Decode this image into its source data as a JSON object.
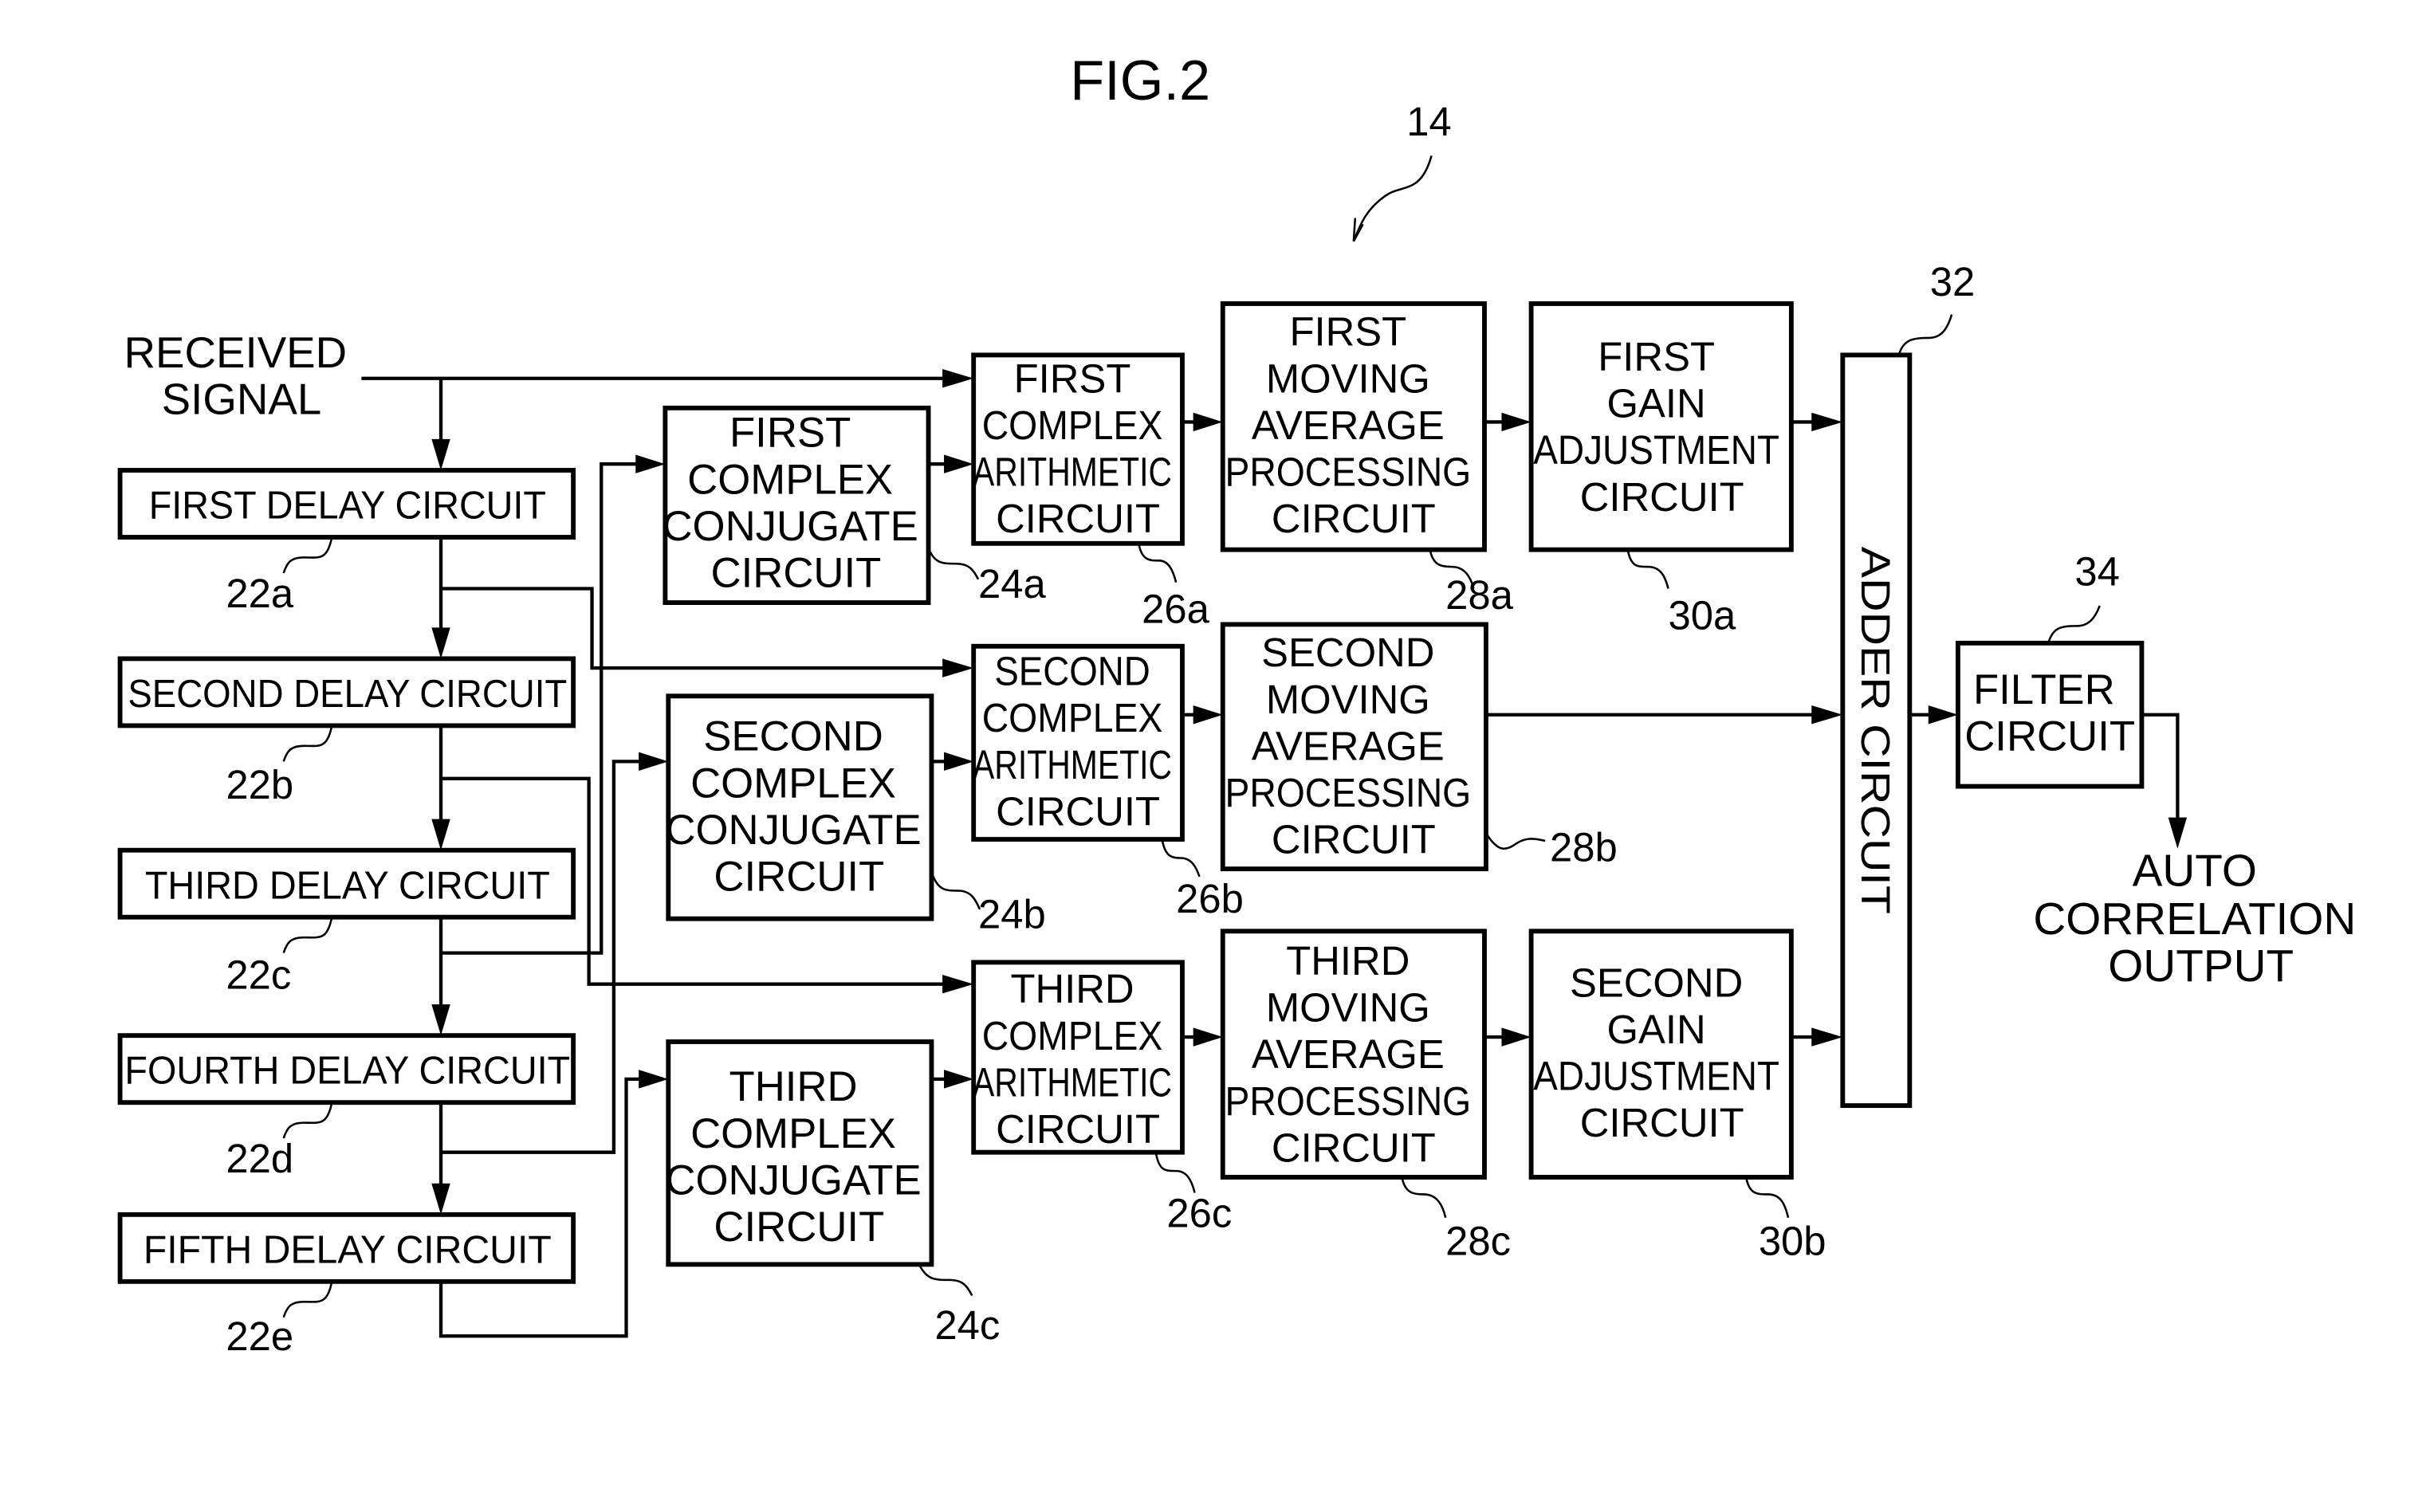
{
  "figure": {
    "title": "FIG.2",
    "system_ref": "14"
  },
  "input": {
    "label_lines": [
      "RECEIVED",
      "SIGNAL"
    ]
  },
  "delay_circuits": [
    {
      "label": "FIRST DELAY CIRCUIT",
      "ref": "22a"
    },
    {
      "label": "SECOND DELAY CIRCUIT",
      "ref": "22b"
    },
    {
      "label": "THIRD DELAY CIRCUIT",
      "ref": "22c"
    },
    {
      "label": "FOURTH DELAY CIRCUIT",
      "ref": "22d"
    },
    {
      "label": "FIFTH DELAY CIRCUIT",
      "ref": "22e"
    }
  ],
  "conjugate_circuits": [
    {
      "lines": [
        "FIRST",
        "COMPLEX",
        "CONJUGATE",
        "CIRCUIT"
      ],
      "ref": "24a"
    },
    {
      "lines": [
        "SECOND",
        "COMPLEX",
        "CONJUGATE",
        "CIRCUIT"
      ],
      "ref": "24b"
    },
    {
      "lines": [
        "THIRD",
        "COMPLEX",
        "CONJUGATE",
        "CIRCUIT"
      ],
      "ref": "24c"
    }
  ],
  "arithmetic_circuits": [
    {
      "lines": [
        "FIRST",
        "COMPLEX",
        "ARITHMETIC",
        "CIRCUIT"
      ],
      "ref": "26a"
    },
    {
      "lines": [
        "SECOND",
        "COMPLEX",
        "ARITHMETIC",
        "CIRCUIT"
      ],
      "ref": "26b"
    },
    {
      "lines": [
        "THIRD",
        "COMPLEX",
        "ARITHMETIC",
        "CIRCUIT"
      ],
      "ref": "26c"
    }
  ],
  "moving_average_circuits": [
    {
      "lines": [
        "FIRST",
        "MOVING",
        "AVERAGE",
        "PROCESSING",
        "CIRCUIT"
      ],
      "ref": "28a"
    },
    {
      "lines": [
        "SECOND",
        "MOVING",
        "AVERAGE",
        "PROCESSING",
        "CIRCUIT"
      ],
      "ref": "28b"
    },
    {
      "lines": [
        "THIRD",
        "MOVING",
        "AVERAGE",
        "PROCESSING",
        "CIRCUIT"
      ],
      "ref": "28c"
    }
  ],
  "gain_circuits": [
    {
      "lines": [
        "FIRST",
        "GAIN",
        "ADJUSTMENT",
        "CIRCUIT"
      ],
      "ref": "30a"
    },
    {
      "lines": [
        "SECOND",
        "GAIN",
        "ADJUSTMENT",
        "CIRCUIT"
      ],
      "ref": "30b"
    }
  ],
  "adder": {
    "label": "ADDER CIRCUIT",
    "ref": "32"
  },
  "filter": {
    "lines": [
      "FILTER",
      "CIRCUIT"
    ],
    "ref": "34"
  },
  "output": {
    "label_lines": [
      "AUTO",
      "CORRELATION",
      "OUTPUT"
    ]
  }
}
